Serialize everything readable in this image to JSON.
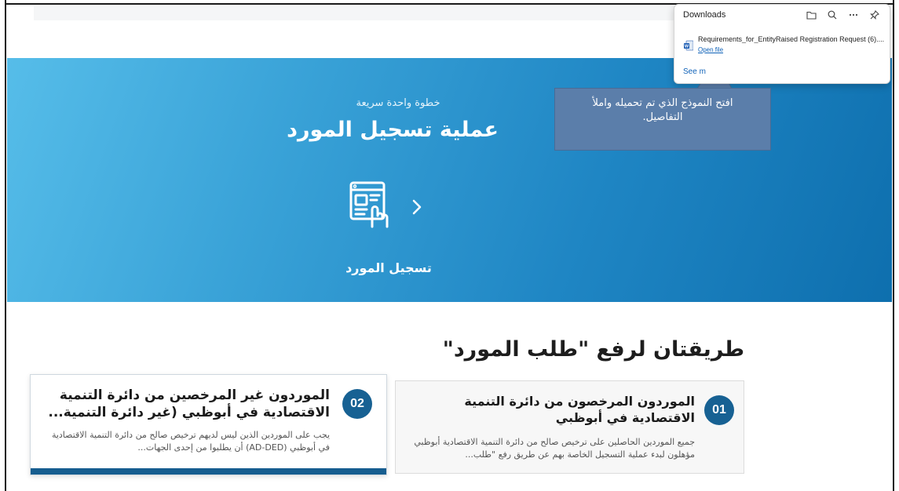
{
  "downloads_panel": {
    "title": "Downloads",
    "tools": [
      "folder-icon",
      "search-icon",
      "more-icon",
      "pin-icon"
    ],
    "file_name": "Requirements_for_EntityRaised Registration Request (6)....",
    "open_file": "Open file",
    "see_more": "See m"
  },
  "callout": {
    "text": "افتح النموذج الذي تم تحميله واملأ التفاصيل."
  },
  "hero": {
    "eyebrow": "خطوة واحدة سريعة",
    "title": "عملية تسجيل المورد",
    "step_label": "تسجيل المورد"
  },
  "section": {
    "title": "طريقتان لرفع \"طلب المورد\""
  },
  "cards": [
    {
      "number": "01",
      "title": "الموردون المرخصون من دائرة التنمية الاقتصادية في أبوظبي",
      "description": "جميع الموردين الحاصلين على ترخيص صالح من دائرة التنمية الاقتصادية أبوظبي مؤهلون لبدء عملية التسجيل الخاصة بهم عن طريق رفع \"طلب..."
    },
    {
      "number": "02",
      "title": "الموردون غير المرخصين من دائرة التنمية الاقتصادية في أبوظبي (غير دائرة التنمية...",
      "description": "يجب على الموردين الذين ليس لديهم ترخيص صالح من دائرة التنمية الاقتصادية في أبوظبي (AD-DED) أن يطلبوا من إحدى الجهات..."
    }
  ],
  "colors": {
    "hero_start": "#56bde9",
    "hero_end": "#0e6fae",
    "badge": "#176193",
    "callout": "#5b7eaa",
    "link": "#0f62b8"
  }
}
